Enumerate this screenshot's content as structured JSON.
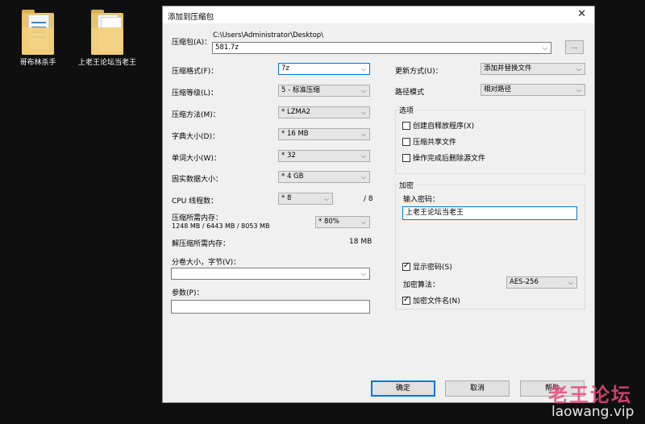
{
  "desktop": {
    "icons": [
      {
        "label": "哥布林杀手"
      },
      {
        "label": "上老王论坛当老王"
      }
    ]
  },
  "dialog": {
    "title": "添加到压缩包",
    "close_glyph": "✕",
    "archive": {
      "label": "压缩包(A)：",
      "path": "C:\\Users\\Administrator\\Desktop\\",
      "value": "581.7z",
      "browse_label": "..."
    },
    "left": {
      "format": {
        "label": "压缩格式(F)：",
        "value": "7z"
      },
      "level": {
        "label": "压缩等级(L)：",
        "value": "5 - 标准压缩"
      },
      "method": {
        "label": "压缩方法(M)：",
        "value": "* LZMA2"
      },
      "dict": {
        "label": "字典大小(D)：",
        "value": "* 16 MB"
      },
      "word": {
        "label": "单词大小(W)：",
        "value": "* 32"
      },
      "solid": {
        "label": "固实数据大小：",
        "value": "* 4 GB"
      },
      "cpu": {
        "label": "CPU 线程数：",
        "value": "* 8",
        "max": "/ 8"
      },
      "mem_compress": {
        "label": "压缩所需内存：",
        "detail": "1248 MB / 6443 MB / 8053 MB",
        "value": "* 80%"
      },
      "mem_decompress": {
        "label": "解压缩所需内存：",
        "value": "18 MB"
      },
      "volume": {
        "label": "分卷大小，字节(V)：",
        "value": ""
      },
      "params": {
        "label": "参数(P)：",
        "value": ""
      }
    },
    "right": {
      "update": {
        "label": "更新方式(U)：",
        "value": "添加并替换文件"
      },
      "path_mode": {
        "label": "路径模式",
        "value": "相对路径"
      },
      "options": {
        "title": "选项",
        "items": [
          {
            "label": "创建自释放程序(X)",
            "checked": false
          },
          {
            "label": "压缩共享文件",
            "checked": false
          },
          {
            "label": "操作完成后删除源文件",
            "checked": false
          }
        ]
      },
      "encryption": {
        "title": "加密",
        "password_label": "输入密码：",
        "password_value": "上老王论坛当老王",
        "show_password": {
          "label": "显示密码(S)",
          "checked": true
        },
        "method_label": "加密算法：",
        "method_value": "AES-256",
        "encrypt_names": {
          "label": "加密文件名(N)",
          "checked": true
        }
      }
    },
    "buttons": {
      "ok": "确定",
      "cancel": "取消",
      "help": "帮助"
    },
    "arrow_glyph": "⌵"
  },
  "watermark": {
    "logo": "老王论坛",
    "url": "laowang.vip"
  },
  "colors": {
    "accent": "#0078d7",
    "watermark": "#e84a79"
  }
}
